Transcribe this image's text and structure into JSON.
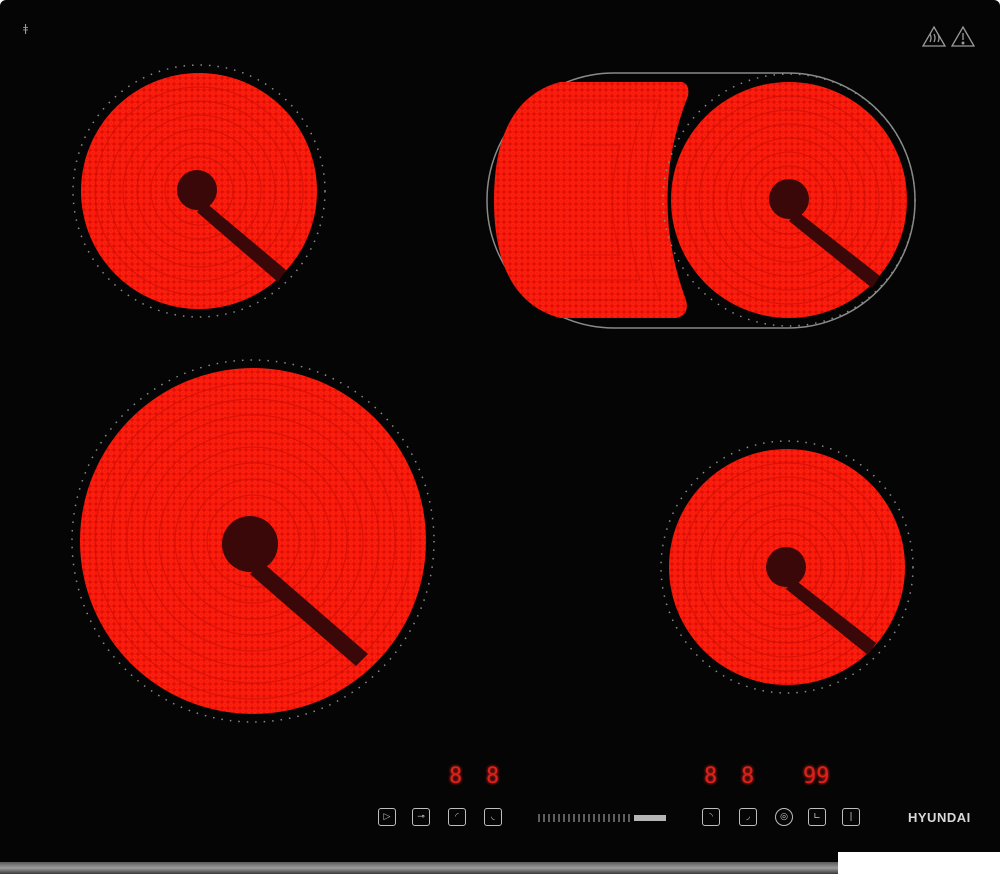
{
  "product": {
    "brand": "HYUNDAI"
  },
  "displays": {
    "left_pair": [
      "8",
      "8"
    ],
    "right_pair": [
      "8",
      "8"
    ],
    "timer": "99"
  },
  "colors": {
    "glass": "#050505",
    "heating_element": "#ff1d0e",
    "display": "#e0201c",
    "ring": "#9a9a9a"
  },
  "icons": {
    "top_right": [
      "hot-surface-warning-icon",
      "warning-triangle-icon"
    ],
    "controls_left": [
      "play-icon",
      "lock-icon",
      "zone-select-icon",
      "zone-select-icon"
    ],
    "controls_right": [
      "zone-select-icon",
      "zone-select-icon",
      "dual-zone-icon",
      "timer-icon",
      "power-icon"
    ]
  }
}
